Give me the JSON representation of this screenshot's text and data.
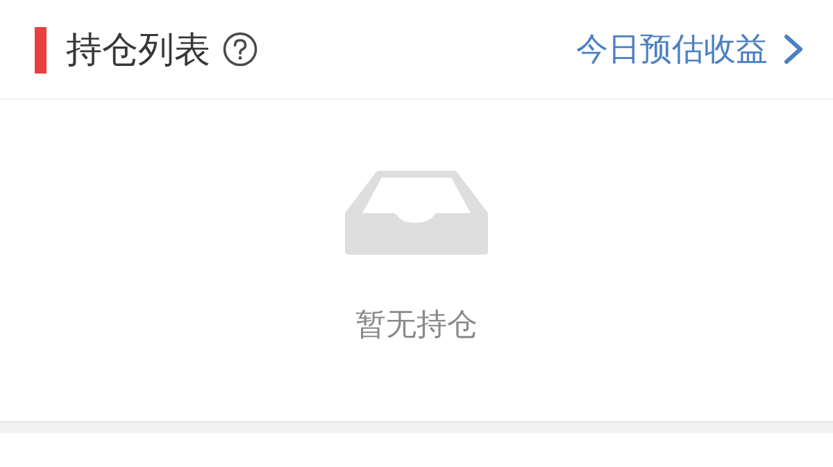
{
  "header": {
    "title": "持仓列表",
    "link": "今日预估收益"
  },
  "empty_state": {
    "message": "暂无持仓"
  }
}
